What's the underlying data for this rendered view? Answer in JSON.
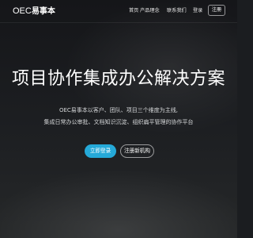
{
  "header": {
    "logo_latin": "OEC",
    "logo_cjk": "易事本",
    "nav": {
      "home": "首页",
      "concept": "产品理念",
      "contact": "联系我们",
      "login": "登录",
      "signup": "注册"
    }
  },
  "hero": {
    "title": "项目协作集成办公解决方案",
    "description_line1": "OEC易事本以客户、团队、项目三个维度为主线,",
    "description_line2": "集成日常办公审批、文档知识沉淀、组织扁平管理的协作平台",
    "primary_button": "立即登录",
    "secondary_button": "注册新机构"
  },
  "colors": {
    "background": "#1b1d20",
    "accent": "#25a9d8",
    "text": "#ffffff"
  }
}
